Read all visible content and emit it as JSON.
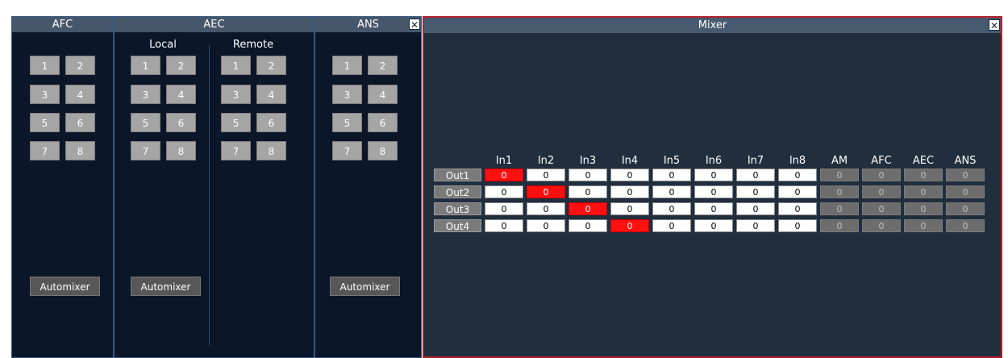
{
  "afc": {
    "title": "AFC",
    "buttons": [
      "1",
      "2",
      "3",
      "4",
      "5",
      "6",
      "7",
      "8"
    ],
    "automixer": "Automixer"
  },
  "aec": {
    "title": "AEC",
    "local_label": "Local",
    "remote_label": "Remote",
    "local_buttons": [
      "1",
      "2",
      "3",
      "4",
      "5",
      "6",
      "7",
      "8"
    ],
    "remote_buttons": [
      "1",
      "2",
      "3",
      "4",
      "5",
      "6",
      "7",
      "8"
    ],
    "automixer": "Automixer"
  },
  "ans": {
    "title": "ANS",
    "close": "✕",
    "buttons": [
      "1",
      "2",
      "3",
      "4",
      "5",
      "6",
      "7",
      "8"
    ],
    "automixer": "Automixer"
  },
  "mixer": {
    "title": "Mixer",
    "close": "✕",
    "columns": [
      "In1",
      "In2",
      "In3",
      "In4",
      "In5",
      "In6",
      "In7",
      "In8",
      "AM",
      "AFC",
      "AEC",
      "ANS"
    ],
    "rows": [
      {
        "label": "Out1",
        "values": [
          "0",
          "0",
          "0",
          "0",
          "0",
          "0",
          "0",
          "0",
          "0",
          "0",
          "0",
          "0"
        ]
      },
      {
        "label": "Out2",
        "values": [
          "0",
          "0",
          "0",
          "0",
          "0",
          "0",
          "0",
          "0",
          "0",
          "0",
          "0",
          "0"
        ]
      },
      {
        "label": "Out3",
        "values": [
          "0",
          "0",
          "0",
          "0",
          "0",
          "0",
          "0",
          "0",
          "0",
          "0",
          "0",
          "0"
        ]
      },
      {
        "label": "Out4",
        "values": [
          "0",
          "0",
          "0",
          "0",
          "0",
          "0",
          "0",
          "0",
          "0",
          "0",
          "0",
          "0"
        ]
      }
    ],
    "highlight_color": "#ff1010"
  }
}
